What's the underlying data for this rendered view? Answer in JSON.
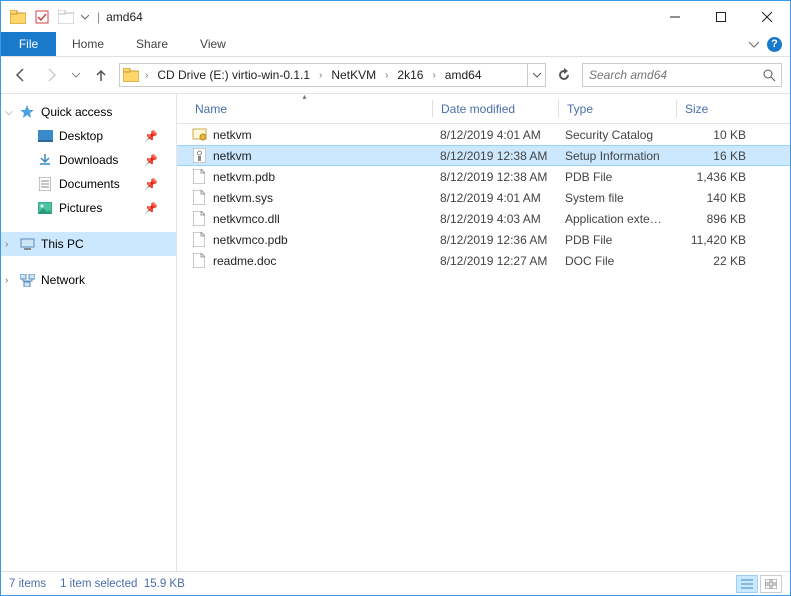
{
  "title": "amd64",
  "ribbon": {
    "file": "File",
    "tabs": [
      "Home",
      "Share",
      "View"
    ]
  },
  "breadcrumb": [
    "CD Drive (E:) virtio-win-0.1.1",
    "NetKVM",
    "2k16",
    "amd64"
  ],
  "search_placeholder": "Search amd64",
  "sidebar": {
    "quick": {
      "label": "Quick access",
      "items": [
        {
          "label": "Desktop",
          "pinned": true
        },
        {
          "label": "Downloads",
          "pinned": true
        },
        {
          "label": "Documents",
          "pinned": true
        },
        {
          "label": "Pictures",
          "pinned": true
        }
      ]
    },
    "thispc": {
      "label": "This PC"
    },
    "network": {
      "label": "Network"
    }
  },
  "columns": {
    "name": "Name",
    "date": "Date modified",
    "type": "Type",
    "size": "Size"
  },
  "files": [
    {
      "name": "netkvm",
      "date": "8/12/2019 4:01 AM",
      "type": "Security Catalog",
      "size": "10 KB",
      "icon": "cert",
      "selected": false
    },
    {
      "name": "netkvm",
      "date": "8/12/2019 12:38 AM",
      "type": "Setup Information",
      "size": "16 KB",
      "icon": "inf",
      "selected": true
    },
    {
      "name": "netkvm.pdb",
      "date": "8/12/2019 12:38 AM",
      "type": "PDB File",
      "size": "1,436 KB",
      "icon": "file",
      "selected": false
    },
    {
      "name": "netkvm.sys",
      "date": "8/12/2019 4:01 AM",
      "type": "System file",
      "size": "140 KB",
      "icon": "file",
      "selected": false
    },
    {
      "name": "netkvmco.dll",
      "date": "8/12/2019 4:03 AM",
      "type": "Application extens...",
      "size": "896 KB",
      "icon": "file",
      "selected": false
    },
    {
      "name": "netkvmco.pdb",
      "date": "8/12/2019 12:36 AM",
      "type": "PDB File",
      "size": "11,420 KB",
      "icon": "file",
      "selected": false
    },
    {
      "name": "readme.doc",
      "date": "8/12/2019 12:27 AM",
      "type": "DOC File",
      "size": "22 KB",
      "icon": "file",
      "selected": false
    }
  ],
  "status": {
    "count": "7 items",
    "selection": "1 item selected",
    "size": "15.9 KB"
  }
}
